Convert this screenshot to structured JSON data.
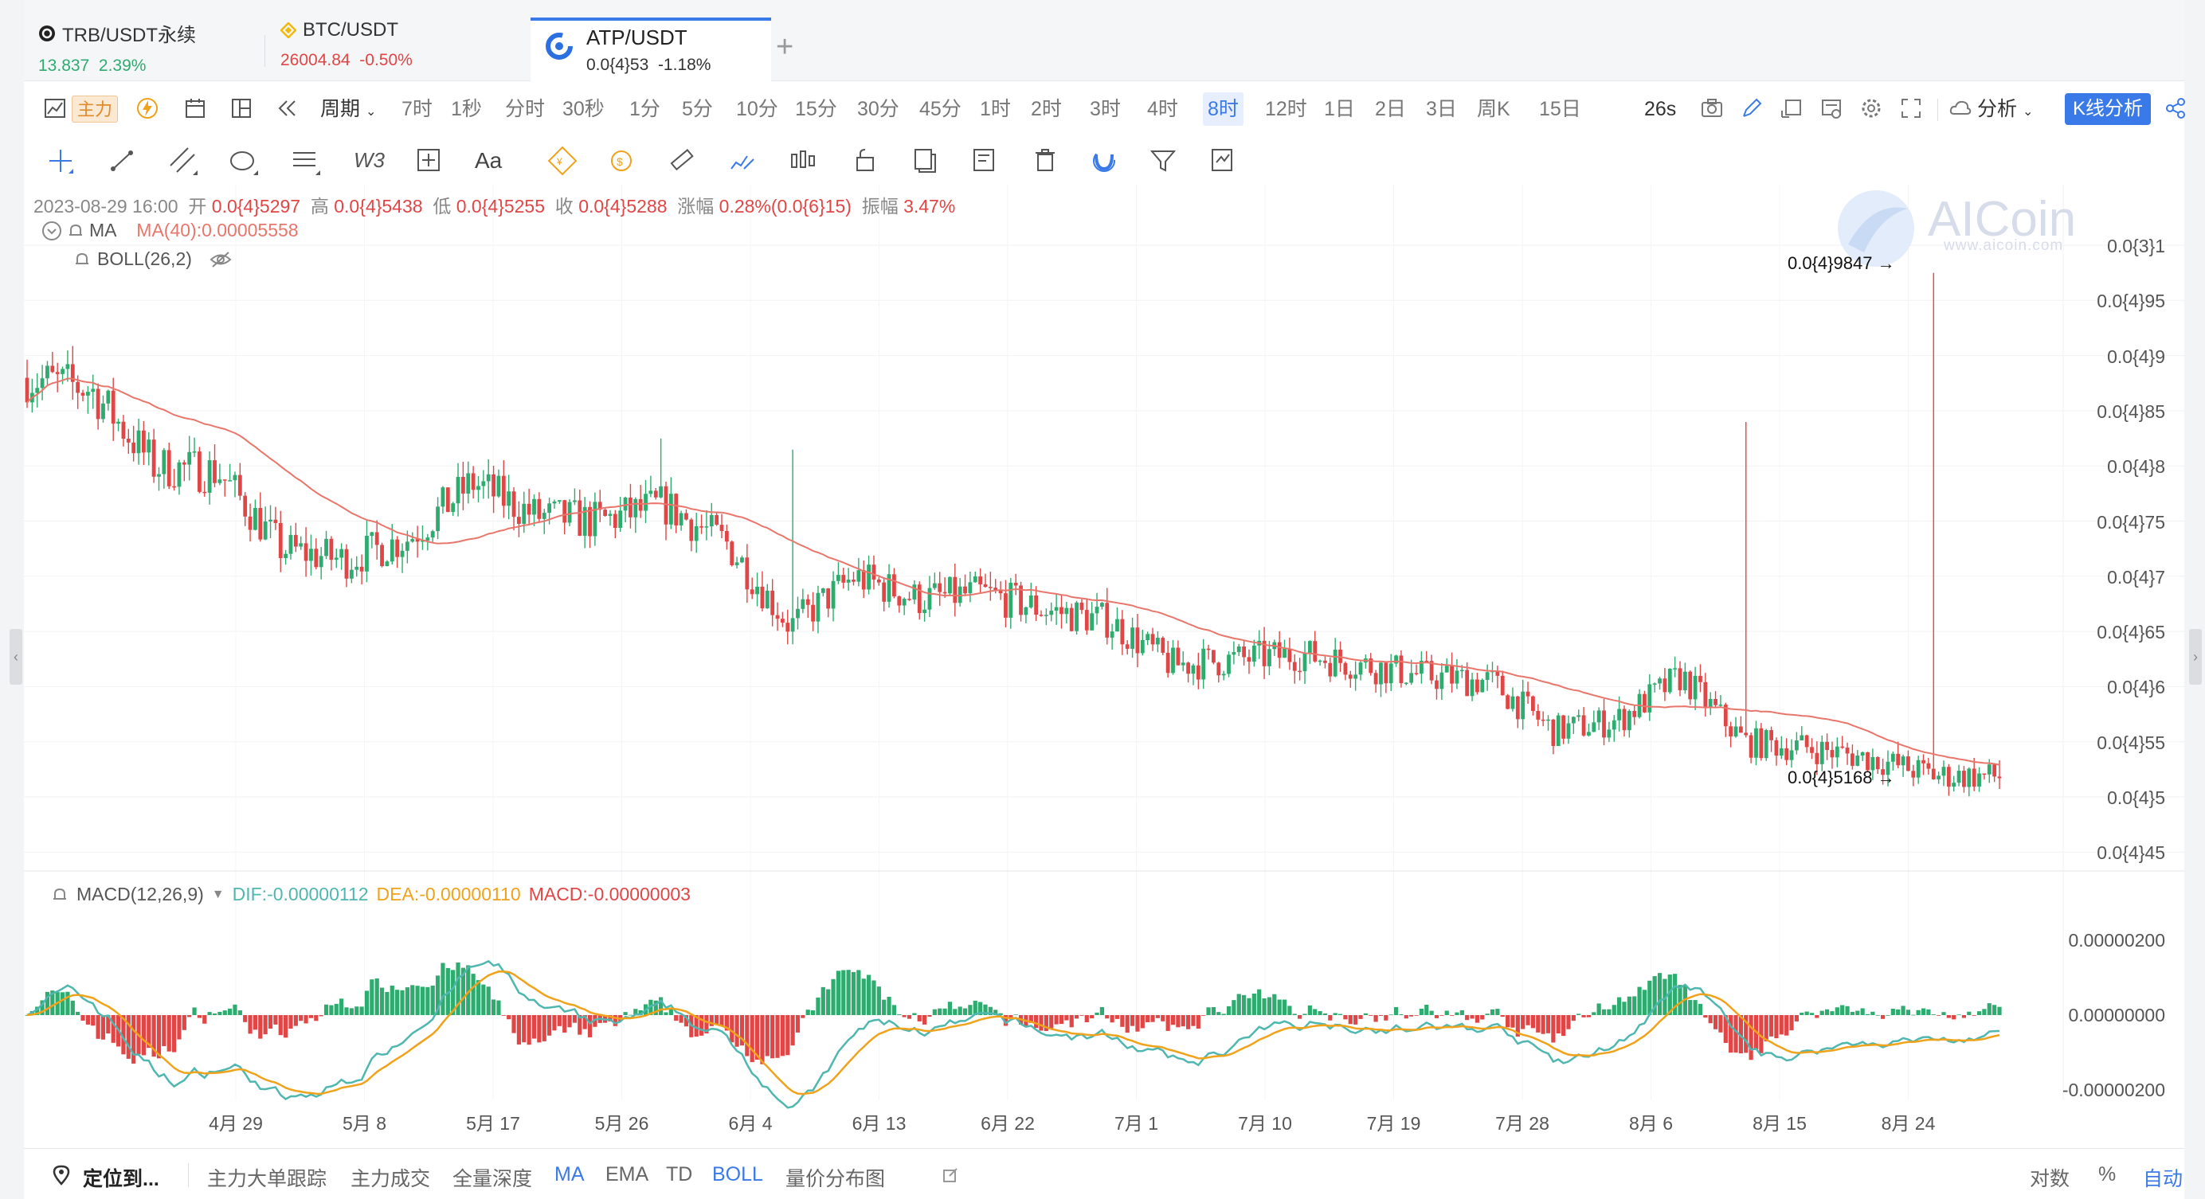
{
  "tabs": [
    {
      "symbol": "TRB/USDT永续",
      "price": "13.837",
      "change": "2.39%",
      "dir": "up"
    },
    {
      "symbol": "BTC/USDT",
      "price": "26004.84",
      "change": "-0.50%",
      "dir": "down"
    },
    {
      "symbol": "ATP/USDT",
      "price": "0.0{4}53",
      "change": "-1.18%",
      "dir": "down",
      "active": true
    }
  ],
  "add_tab": "+",
  "toolbar": {
    "main_force": "主力",
    "period": "周期",
    "intervals": [
      "7时",
      "1秒",
      "分时",
      "30秒",
      "1分",
      "5分",
      "10分",
      "15分",
      "30分",
      "45分",
      "1时",
      "2时",
      "3时",
      "4时",
      "8时",
      "12时",
      "1日",
      "2日",
      "3日",
      "周K",
      "15日"
    ],
    "selected_interval": "8时",
    "countdown": "26s",
    "analysis": "分析",
    "kline_analysis": "K线分析"
  },
  "draw_tools": {
    "text_tool": "Aa",
    "wave_tool": "W3"
  },
  "info": {
    "datetime": "2023-08-29 16:00",
    "open_label": "开",
    "open": "0.0{4}5297",
    "high_label": "高",
    "high": "0.0{4}5438",
    "low_label": "低",
    "low": "0.0{4}5255",
    "close_label": "收",
    "close": "0.0{4}5288",
    "change_label": "涨幅",
    "change": "0.28%(0.0{6}15)",
    "amp_label": "振幅",
    "amp": "3.47%"
  },
  "indicators": {
    "ma_label": "MA",
    "ma_value": "MA(40):0.00005558",
    "boll_label": "BOLL(26,2)",
    "macd_label": "MACD(12,26,9)",
    "dif": "DIF:-0.00000112",
    "dea": "DEA:-0.00000110",
    "macd": "MACD:-0.00000003"
  },
  "watermark": {
    "brand": "AICoin",
    "url": "www.aicoin.com"
  },
  "price_axis": [
    "0.0{3}1",
    "0.0{4}95",
    "0.0{4}9",
    "0.0{4}85",
    "0.0{4}8",
    "0.0{4}75",
    "0.0{4}7",
    "0.0{4}65",
    "0.0{4}6",
    "0.0{4}55",
    "0.0{4}5",
    "0.0{4}45"
  ],
  "macd_axis": [
    "0.00000200",
    "0.00000000",
    "-0.00000200"
  ],
  "time_axis": [
    "4月 29",
    "5月 8",
    "5月 17",
    "5月 26",
    "6月 4",
    "6月 13",
    "6月 22",
    "7月 1",
    "7月 10",
    "7月 19",
    "7月 28",
    "8月 6",
    "8月 15",
    "8月 24"
  ],
  "annotations": {
    "high_mark": "0.0{4}9847 →",
    "low_mark": "0.0{4}5168 →"
  },
  "colors": {
    "up": "#2eab6e",
    "down": "#e04646",
    "ma": "#e9766b",
    "dif": "#4fb7b0",
    "dea": "#f0a21a",
    "accent": "#3a7ae8"
  },
  "bottom_bar": {
    "locate": "定位到...",
    "items": [
      "主力大单跟踪",
      "主力成交",
      "全量深度",
      "MA",
      "EMA",
      "TD",
      "BOLL",
      "量价分布图"
    ],
    "active_items": [
      "MA",
      "BOLL"
    ],
    "log_scale": "对数",
    "percent": "%",
    "auto": "自动"
  },
  "chart_data": {
    "type": "candlestick",
    "symbol": "ATP/USDT",
    "interval": "8时",
    "x_labels": [
      "4月 29",
      "5月 8",
      "5月 17",
      "5月 26",
      "6月 4",
      "6月 13",
      "6月 22",
      "7月 1",
      "7月 10",
      "7月 19",
      "7月 28",
      "8月 6",
      "8月 15",
      "8月 24"
    ],
    "price_range_approx": [
      4.45e-05,
      0.000101
    ],
    "close_path_approx": [
      {
        "date": "4月 21",
        "close": 8.9e-05
      },
      {
        "date": "4月 25",
        "close": 8.8e-05
      },
      {
        "date": "4月 29",
        "close": 8.1e-05
      },
      {
        "date": "5月 3",
        "close": 8.05e-05
      },
      {
        "date": "5月 8",
        "close": 7.35e-05
      },
      {
        "date": "5月 12",
        "close": 7.25e-05
      },
      {
        "date": "5月 17",
        "close": 7.45e-05
      },
      {
        "date": "5月 21",
        "close": 7.95e-05
      },
      {
        "date": "5月 26",
        "close": 7.65e-05
      },
      {
        "date": "5月 30",
        "close": 7.6e-05
      },
      {
        "date": "6月 4",
        "close": 7.75e-05
      },
      {
        "date": "6月 8",
        "close": 7.4e-05
      },
      {
        "date": "6月 13",
        "close": 6.65e-05
      },
      {
        "date": "6月 17",
        "close": 7.1e-05
      },
      {
        "date": "6月 22",
        "close": 6.9e-05
      },
      {
        "date": "6月 26",
        "close": 6.95e-05
      },
      {
        "date": "7月 1",
        "close": 6.8e-05
      },
      {
        "date": "7月 5",
        "close": 6.7e-05
      },
      {
        "date": "7月 10",
        "close": 6.3e-05
      },
      {
        "date": "7月 14",
        "close": 6.35e-05
      },
      {
        "date": "7月 19",
        "close": 6.4e-05
      },
      {
        "date": "7月 24",
        "close": 6.3e-05
      },
      {
        "date": "7月 28",
        "close": 6.2e-05
      },
      {
        "date": "8月 2",
        "close": 6.15e-05
      },
      {
        "date": "8月 6",
        "close": 5.7e-05
      },
      {
        "date": "8月 10",
        "close": 5.8e-05
      },
      {
        "date": "8月 13",
        "close": 6.2e-05
      },
      {
        "date": "8月 15",
        "close": 5.6e-05
      },
      {
        "date": "8月 20",
        "close": 5.55e-05
      },
      {
        "date": "8月 22",
        "close": 5.45e-05
      },
      {
        "date": "8月 24",
        "close": 5.3e-05
      },
      {
        "date": "8月 29",
        "close": 5.29e-05
      }
    ],
    "spikes": [
      {
        "date": "6月 4",
        "high": 8.35e-05
      },
      {
        "date": "6月 13",
        "high": 8.25e-05
      },
      {
        "date": "8月 15",
        "high": 8.5e-05
      },
      {
        "date": "8月 24",
        "high": 9.85e-05
      }
    ],
    "highest": 9.847e-05,
    "lowest": 5.168e-05,
    "ma40_last": 5.558e-05,
    "macd": {
      "axis_range": [
        -2.5e-06,
        2.5e-06
      ],
      "dif_last": -1.12e-06,
      "dea_last": -1.1e-06,
      "hist_last": -3e-08
    }
  }
}
